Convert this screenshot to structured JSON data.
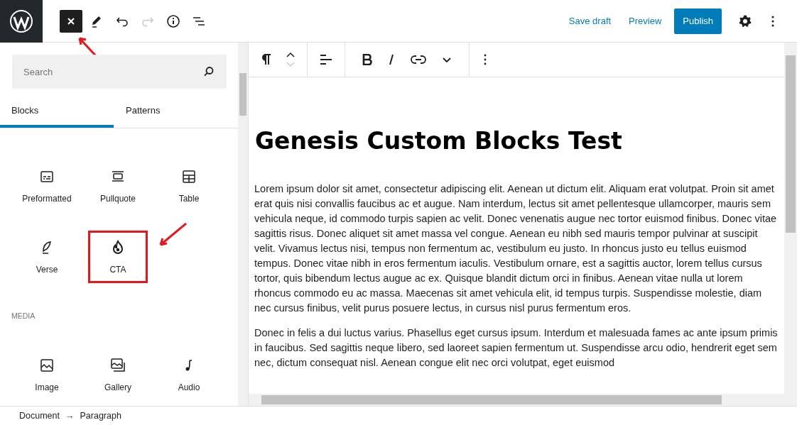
{
  "header": {
    "tools": [
      {
        "kind": "close",
        "selected": true,
        "annotated": true
      },
      {
        "kind": "edit",
        "selected": false
      },
      {
        "kind": "undo",
        "disabled": false
      },
      {
        "kind": "redo",
        "disabled": true
      },
      {
        "kind": "info",
        "disabled": false
      },
      {
        "kind": "outline",
        "disabled": false
      }
    ],
    "save_draft": "Save draft",
    "preview": "Preview",
    "publish": "Publish"
  },
  "inserter": {
    "search": {
      "placeholder": "Search"
    },
    "tabs": [
      {
        "label": "Blocks",
        "selected": true
      },
      {
        "label": "Patterns",
        "selected": false
      }
    ],
    "blocks": [
      {
        "label": "Preformatted",
        "highlighted": false
      },
      {
        "label": "Pullquote",
        "highlighted": false
      },
      {
        "label": "Table",
        "highlighted": false
      },
      {
        "label": "Verse",
        "highlighted": false
      },
      {
        "label": "CTA",
        "highlighted": true
      }
    ],
    "section": "MEDIA",
    "media_blocks": [
      {
        "label": "Image",
        "highlighted": false
      },
      {
        "label": "Gallery",
        "highlighted": false
      },
      {
        "label": "Audio",
        "highlighted": false
      }
    ]
  },
  "block_toolbar": {
    "mover_down_disabled": true
  },
  "editor": {
    "title": "Genesis Custom Blocks Test",
    "paragraphs": [
      "Lorem ipsum dolor sit amet, consectetur adipiscing elit. Aenean ut dictum elit. Aliquam erat volutpat. Proin sit amet erat quis nisi convallis faucibus ac et augue. Nam interdum, lectus sit amet pellentesque ullamcorper, mauris sem vehicula neque, id commodo turpis sapien ac velit. Donec venenatis augue nec tortor euismod finibus. Donec vitae sagittis risus. Donec aliquet sit amet massa vel congue. Aenean eu nibh sed mauris tempor pulvinar at suscipit velit. Vivamus lectus nisi, tempus non fermentum ac, vestibulum eu justo. In rhoncus justo eu tellus euismod tempus. Donec vitae nibh in eros fermentum iaculis. Vestibulum ornare, est a sagittis auctor, lorem tellus cursus tortor, quis bibendum lectus augue ac ex. Quisque blandit dictum orci in finibus. Aenean vitae nulla ut lorem rhoncus commodo eu ac massa. Maecenas sit amet vehicula elit, id tempus turpis. Suspendisse molestie, diam nec cursus finibus, velit purus posuere lectus, in cursus nisl purus fermentum eros.",
      "Donec in felis a dui luctus varius. Phasellus eget cursus ipsum. Interdum et malesuada fames ac ante ipsum primis in faucibus. Sed sagittis neque libero, sed laoreet sapien fermentum ut. Suspendisse arcu odio, hendrerit eget sem nec, dictum consequat nisl. Aenean congue elit nec orci volutpat, eget euismod"
    ]
  },
  "breadcrumb": [
    "Document",
    "→",
    "Paragraph"
  ]
}
